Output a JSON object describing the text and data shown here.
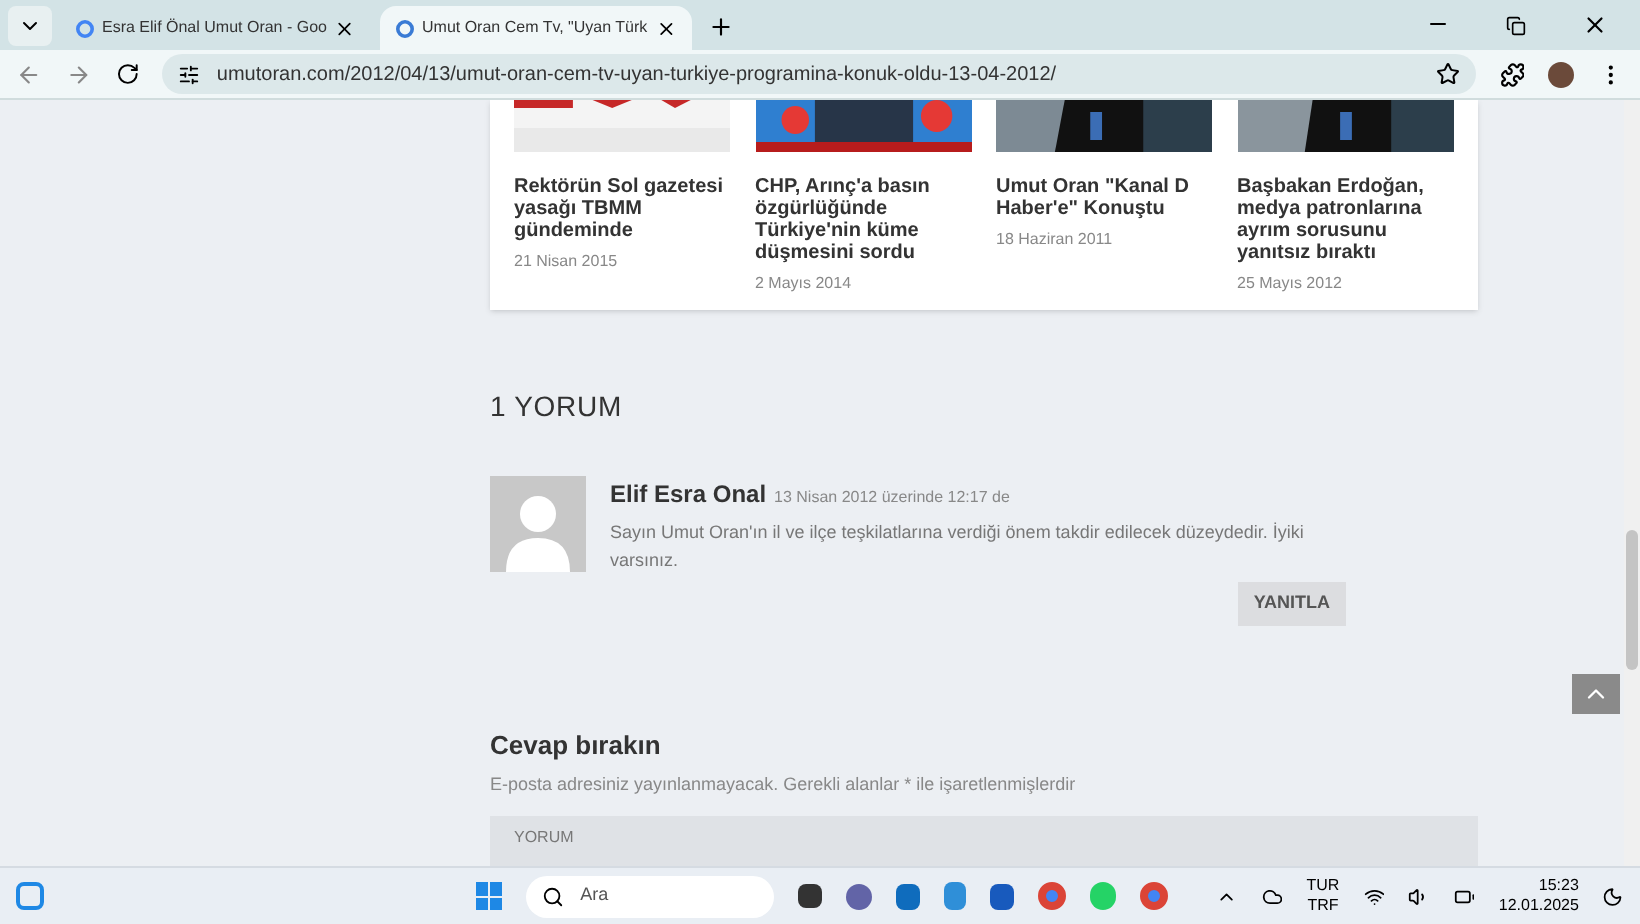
{
  "browser": {
    "tabs": [
      {
        "title": "Esra Elif Önal Umut Oran - Goo",
        "selected": false
      },
      {
        "title": "Umut Oran Cem Tv, \"Uyan Türk",
        "selected": true
      }
    ],
    "url": "umutoran.com/2012/04/13/umut-oran-cem-tv-uyan-turkiye-programina-konuk-oldu-13-04-2012/"
  },
  "related_posts": [
    {
      "title": "Rektörün Sol gazetesi yasağı TBMM gündeminde",
      "date": "21 Nisan 2015"
    },
    {
      "title": "CHP, Arınç'a basın özgürlüğünde Türkiye'nin küme düşmesini sordu",
      "date": "2 Mayıs 2014"
    },
    {
      "title": "Umut Oran \"Kanal D Haber'e\" Konuştu",
      "date": "18 Haziran 2011"
    },
    {
      "title": "Başbakan Erdoğan, medya patronlarına ayrım sorusunu yanıtsız bıraktı",
      "date": "25 Mayıs 2012"
    }
  ],
  "comments_heading": "1 YORUM",
  "comments": [
    {
      "author": "Elif Esra Onal",
      "meta": "13 Nisan 2012 üzerinde 12:17 de",
      "text": "Sayın Umut Oran'ın il ve ilçe teşkilatlarına verdiği önem takdir edilecek düzeydedir. İyiki varsınız.",
      "reply": "YANITLA"
    }
  ],
  "reply_form": {
    "title": "Cevap bırakın",
    "note": "E-posta adresiniz yayınlanmayacak. Gerekli alanlar * ile işaretlenmişlerdir",
    "placeholder": "YORUM"
  },
  "taskbar": {
    "search_placeholder": "Ara",
    "language": "TUR",
    "layout": "TRF",
    "time": "15:23",
    "date": "12.01.2025"
  }
}
